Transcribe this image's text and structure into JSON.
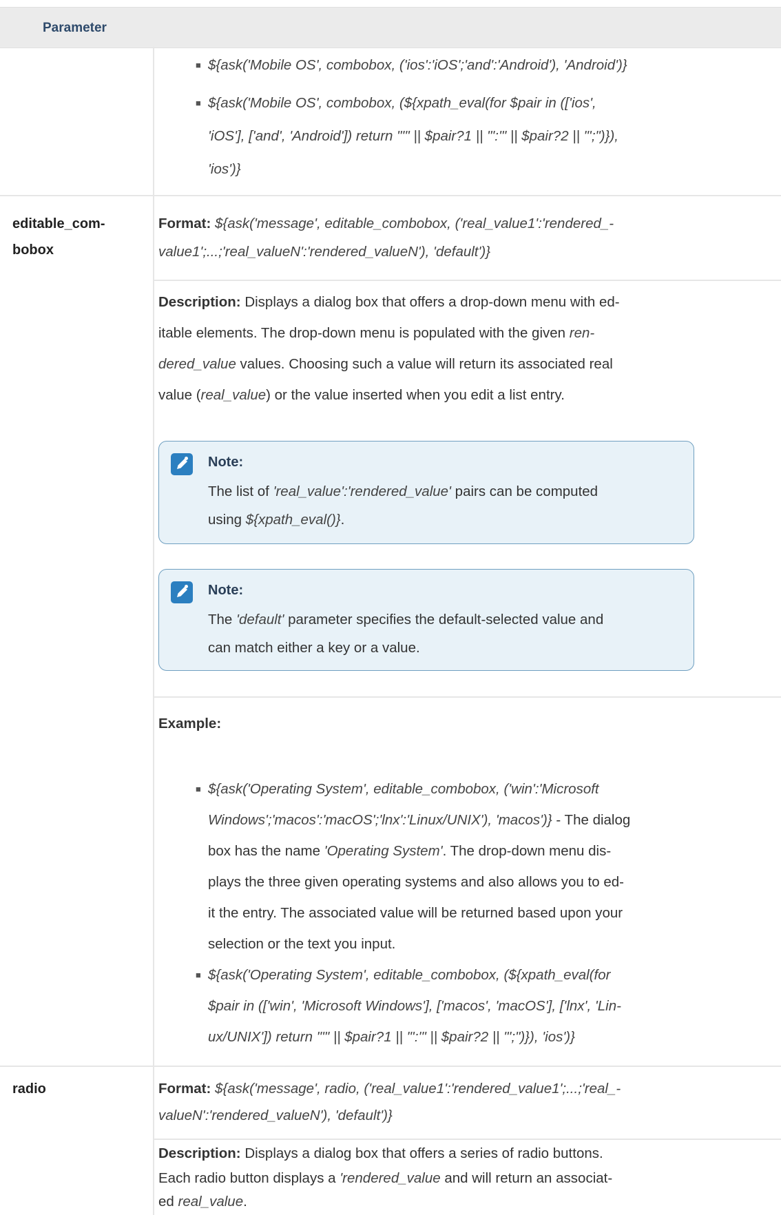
{
  "header": {
    "parameter": "Parameter"
  },
  "combobox_cont": {
    "ex1": "${ask('Mobile OS', combobox, ('ios':'iOS';'and':'Android'), 'Android')}",
    "ex2_l1": "${ask('Mobile OS', combobox, (${xpath_eval(for $pair in (['ios',",
    "ex2_l2": "'iOS'], ['and', 'Android']) return \"'\" || $pair?1 || \"':'\" || $pair?2 || \"';\")}),",
    "ex2_l3": "'ios')}"
  },
  "editable": {
    "name_l1": "editable_com-",
    "name_l2": "bobox",
    "format_label": "Format:",
    "format_l1": "${ask('message', editable_combobox, ('real_value1':'rendered_-",
    "format_l2": "value1';...;'real_valueN':'rendered_valueN'), 'default')}",
    "desc_label": "Description:",
    "desc_l1": "Displays a dialog box that offers a drop-down menu with ed-",
    "desc_l2_a": "itable elements. The drop-down menu is populated with the given ",
    "desc_l2_b": "ren-",
    "desc_l3_a": "dered_value",
    "desc_l3_b": " values. Choosing such a value will return its associated real",
    "desc_l4_a": "value (",
    "desc_l4_b": "real_value",
    "desc_l4_c": ") or the value inserted when you edit a list entry.",
    "note1_title": "Note:",
    "note1_l1_a": "The list of ",
    "note1_l1_b": "'real_value':'rendered_value'",
    "note1_l1_c": " pairs can be computed",
    "note1_l2_a": "using ",
    "note1_l2_b": "${xpath_eval()}",
    "note1_l2_c": ".",
    "note2_title": "Note:",
    "note2_l1_a": "The ",
    "note2_l1_b": "'default'",
    "note2_l1_c": " parameter specifies the default-selected value and",
    "note2_l2": "can match either a key or a value.",
    "example_label": "Example:",
    "ex1_l1": "${ask('Operating System', editable_combobox, ('win':'Microsoft",
    "ex1_l2_a": "Windows';'macos':'macOS';'lnx':'Linux/UNIX'), 'macos')}",
    "ex1_l2_b": " - The dialog",
    "ex1_l3_a": "box has the name ",
    "ex1_l3_b": "'Operating System'",
    "ex1_l3_c": ". The drop-down menu dis-",
    "ex1_l4": "plays the three given operating systems and also allows you to ed-",
    "ex1_l5": "it the entry. The associated value will be returned based upon your",
    "ex1_l6": "selection or the text you input.",
    "ex2_l1": "${ask('Operating System', editable_combobox, (${xpath_eval(for",
    "ex2_l2": "$pair in (['win', 'Microsoft Windows'], ['macos', 'macOS'], ['lnx', 'Lin-",
    "ex2_l3": "ux/UNIX']) return \"'\" || $pair?1 || \"':'\" || $pair?2 || \"';\")}), 'ios')}"
  },
  "radio": {
    "name": "radio",
    "format_label": "Format:",
    "format_l1": "${ask('message', radio, ('real_value1':'rendered_value1';...;'real_-",
    "format_l2": "valueN':'rendered_valueN'), 'default')}",
    "desc_label": "Description:",
    "desc_l1": "Displays a dialog box that offers a series of radio buttons.",
    "desc_l2_a": "Each radio button displays a ",
    "desc_l2_b": "'rendered_value",
    "desc_l2_c": " and will return an associat-",
    "desc_l3_a": "ed ",
    "desc_l3_b": "real_value",
    "desc_l3_c": "."
  }
}
